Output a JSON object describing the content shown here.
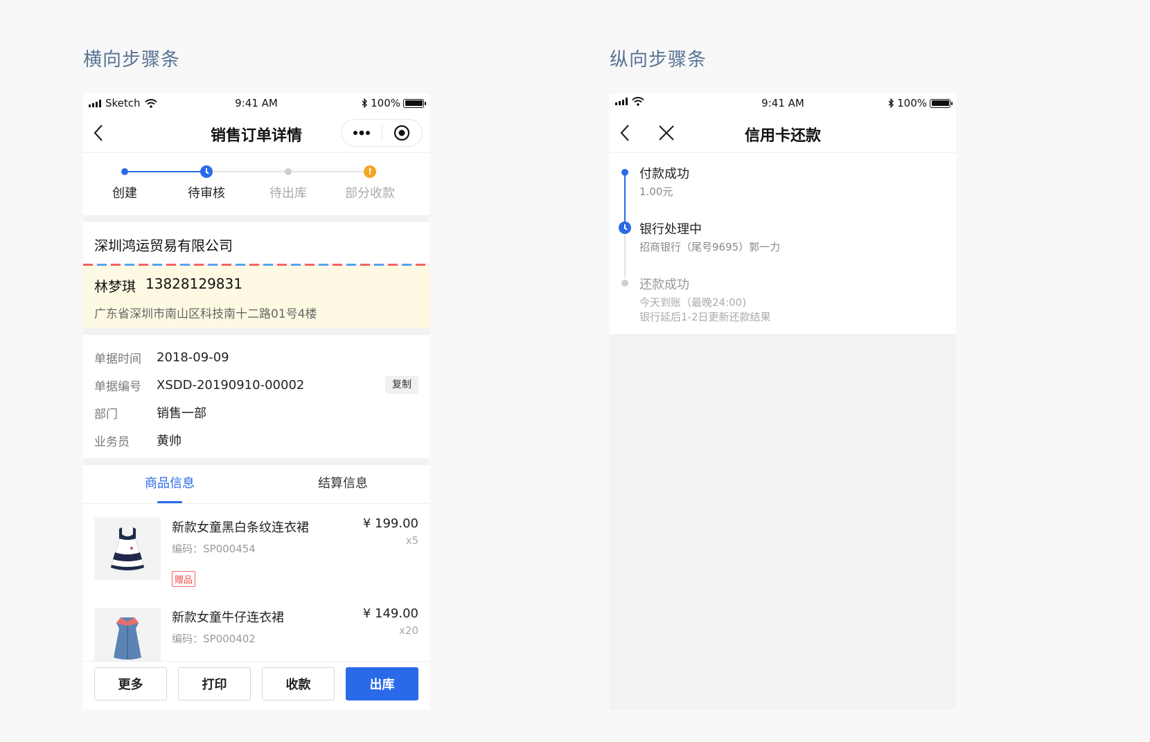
{
  "section_titles": {
    "left": "横向步骤条",
    "right": "纵向步骤条"
  },
  "status_bar": {
    "carrier": "Sketch",
    "time": "9:41 AM",
    "battery": "100%",
    "battery_level": 1.0
  },
  "order_page": {
    "title": "销售订单详情",
    "steps": [
      {
        "label": "创建",
        "state": "done"
      },
      {
        "label": "待审核",
        "state": "current"
      },
      {
        "label": "待出库",
        "state": "todo"
      },
      {
        "label": "部分收款",
        "state": "warning"
      }
    ],
    "company": "深圳鸿运贸易有限公司",
    "contact": {
      "name": "林梦琪",
      "phone": "13828129831",
      "address": "广东省深圳市南山区科技南十二路01号4楼"
    },
    "info": [
      {
        "key": "单据时间",
        "value": "2018-09-09"
      },
      {
        "key": "单据编号",
        "value": "XSDD-20190910-00002"
      },
      {
        "key": "部门",
        "value": "销售一部"
      },
      {
        "key": "业务员",
        "value": "黄帅"
      }
    ],
    "copy_label": "复制",
    "tabs": [
      {
        "label": "商品信息",
        "active": true
      },
      {
        "label": "结算信息",
        "active": false
      }
    ],
    "goods": [
      {
        "name": "新款女童黑白条纹连衣裙",
        "code": "编码：SP000454",
        "price": "¥ 199.00",
        "qty": "x5",
        "tag": "赠品"
      },
      {
        "name": "新款女童牛仔连衣裙",
        "code": "编码：SP000402",
        "price": "¥ 149.00",
        "qty": "x20",
        "tag": ""
      }
    ],
    "buttons": {
      "more": "更多",
      "print": "打印",
      "collect": "收款",
      "ship": "出库"
    }
  },
  "repay_page": {
    "title": "信用卡还款",
    "steps": [
      {
        "title": "付款成功",
        "desc": [
          "1.00元"
        ],
        "state": "done"
      },
      {
        "title": "银行处理中",
        "desc": [
          "招商银行（尾号9695）郭一力"
        ],
        "state": "current"
      },
      {
        "title": "还款成功",
        "desc": [
          "今天到账（最晚24:00)",
          "银行延后1-2日更新还款结果"
        ],
        "state": "todo"
      }
    ]
  },
  "colors": {
    "accent": "#2a6ae8",
    "warning": "#f5a623",
    "section_title": "#5a7395",
    "contact_bg": "#fdf9e2",
    "gift_tag": "#f04545"
  }
}
